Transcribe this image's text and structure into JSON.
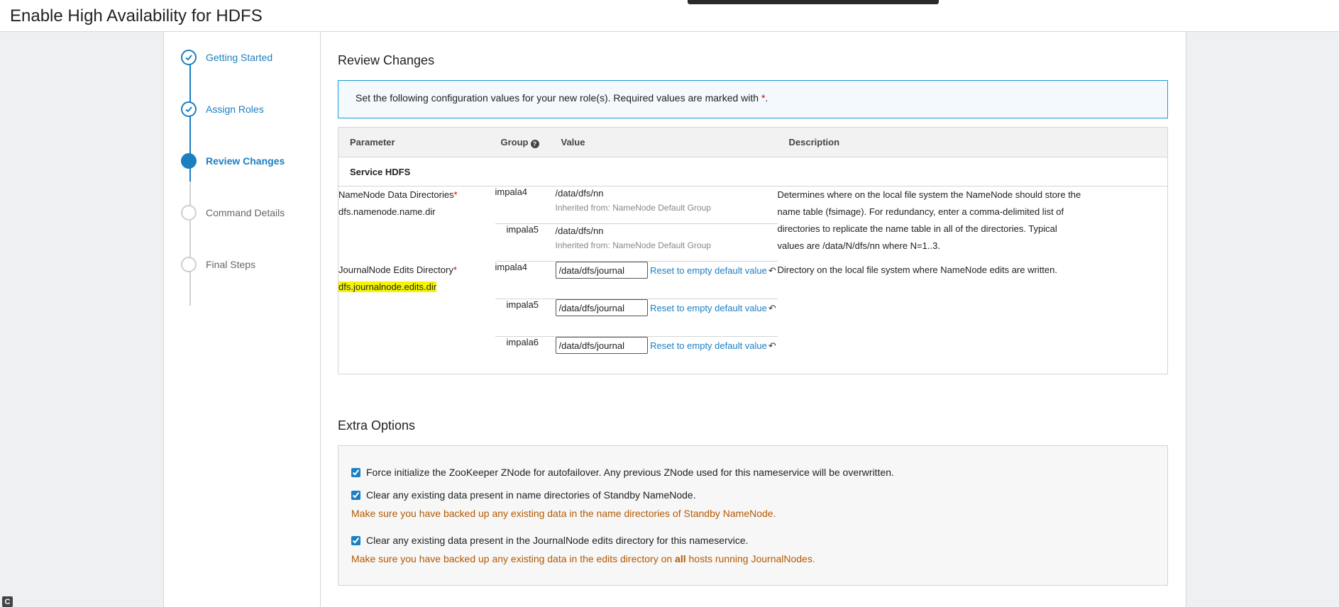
{
  "page": {
    "title": "Enable High Availability for HDFS"
  },
  "steps": [
    {
      "label": "Getting Started",
      "state": "done"
    },
    {
      "label": "Assign Roles",
      "state": "done"
    },
    {
      "label": "Review Changes",
      "state": "active"
    },
    {
      "label": "Command Details",
      "state": "todo"
    },
    {
      "label": "Final Steps",
      "state": "todo"
    }
  ],
  "review": {
    "heading": "Review Changes",
    "info_text": "Set the following configuration values for your new role(s). Required values are marked with ",
    "info_star": "*",
    "info_end": "."
  },
  "table": {
    "headers": {
      "parameter": "Parameter",
      "group": "Group",
      "value": "Value",
      "description": "Description"
    },
    "service_label": "Service HDFS",
    "namenode": {
      "name": "NameNode Data Directories",
      "key": "dfs.namenode.name.dir",
      "rows": [
        {
          "group": "impala4",
          "value": "/data/dfs/nn",
          "inherited": "Inherited from: NameNode Default Group"
        },
        {
          "group": "impala5",
          "value": "/data/dfs/nn",
          "inherited": "Inherited from: NameNode Default Group"
        }
      ],
      "description": "Determines where on the local file system the NameNode should store the name table (fsimage). For redundancy, enter a comma-delimited list of directories to replicate the name table in all of the directories. Typical values are /data/N/dfs/nn where N=1..3."
    },
    "journal": {
      "name": "JournalNode Edits Directory",
      "key": "dfs.journalnode.edits.dir",
      "rows": [
        {
          "group": "impala4",
          "value": "/data/dfs/journal",
          "reset": "Reset to empty default value"
        },
        {
          "group": "impala5",
          "value": "/data/dfs/journal",
          "reset": "Reset to empty default value"
        },
        {
          "group": "impala6",
          "value": "/data/dfs/journal",
          "reset": "Reset to empty default value"
        }
      ],
      "description": "Directory on the local file system where NameNode edits are written."
    },
    "required_mark": "*"
  },
  "extra": {
    "heading": "Extra Options",
    "opt1": "Force initialize the ZooKeeper ZNode for autofailover. Any previous ZNode used for this nameservice will be overwritten.",
    "opt2": "Clear any existing data present in name directories of Standby NameNode.",
    "warn2": "Make sure you have backed up any existing data in the name directories of Standby NameNode.",
    "opt3": "Clear any existing data present in the JournalNode edits directory for this nameservice.",
    "warn3_pre": "Make sure you have backed up any existing data in the edits directory on ",
    "warn3_bold": "all",
    "warn3_post": " hosts running JournalNodes.",
    "checked": [
      true,
      true,
      true
    ]
  },
  "badge": "C",
  "colors": {
    "accent": "#1b7fc1",
    "warning": "#b35900",
    "required": "#cc0000",
    "highlight": "#f5f500"
  }
}
